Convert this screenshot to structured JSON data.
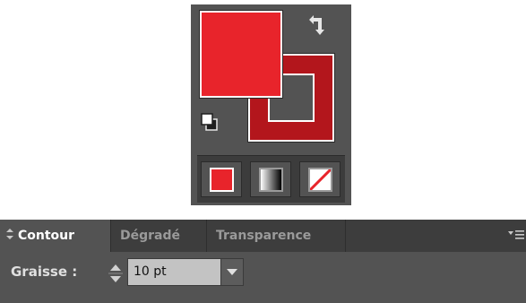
{
  "colors": {
    "fill": "#e8242b",
    "stroke": "#b3161c",
    "panel_bg": "#535353",
    "tab_bar_bg": "#3d3d3d"
  },
  "tools_color_widget": {
    "fill_swatch_color": "#e8242b",
    "stroke_swatch_color": "#b3161c",
    "icons": [
      "swap-fill-stroke-icon",
      "default-fill-stroke-icon"
    ],
    "mode_buttons": [
      {
        "name": "color",
        "icon": "solid-color-icon"
      },
      {
        "name": "gradient",
        "icon": "gradient-icon"
      },
      {
        "name": "none",
        "icon": "none-icon"
      }
    ]
  },
  "stroke_panel": {
    "tabs": [
      {
        "label": "Contour",
        "active": true
      },
      {
        "label": "Dégradé",
        "active": false
      },
      {
        "label": "Transparence",
        "active": false
      }
    ],
    "menu_icon": "panel-menu-icon",
    "weight_label": "Graisse :",
    "weight_value": "10 pt"
  }
}
